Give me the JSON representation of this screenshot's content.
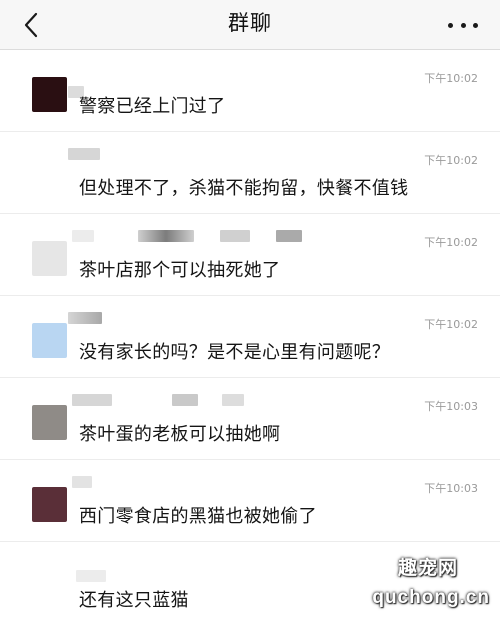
{
  "header": {
    "title": "群聊",
    "back_icon": "chevron-left-icon",
    "more_icon": "more-dots-icon"
  },
  "messages": [
    {
      "time": "下午10:02",
      "text": "警察已经上门过了",
      "avatar_color": "#2a0f12"
    },
    {
      "time": "下午10:02",
      "text": "但处理不了，杀猫不能拘留，快餐不值钱",
      "avatar_color": "#ffffff"
    },
    {
      "time": "下午10:02",
      "text": "茶叶店那个可以抽死她了",
      "avatar_color": "#e6e6e6"
    },
    {
      "time": "下午10:02",
      "text": "没有家长的吗？是不是心里有问题呢？",
      "avatar_color": "#b9d6f2"
    },
    {
      "time": "下午10:03",
      "text": "茶叶蛋的老板可以抽她啊",
      "avatar_color": "#8f8b87"
    },
    {
      "time": "下午10:03",
      "text": "西门零食店的黑猫也被她偷了",
      "avatar_color": "#5a2f38"
    },
    {
      "time": "",
      "text": "还有这只蓝猫",
      "avatar_color": "#ffffff"
    }
  ],
  "watermark": {
    "logo": "趣宠网",
    "url": "quchong.cn"
  }
}
